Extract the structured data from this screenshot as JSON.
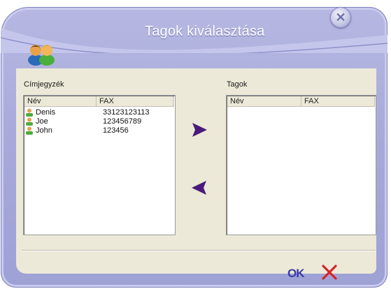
{
  "window": {
    "title": "Tagok kiválasztása",
    "close_symbol": "✕"
  },
  "address_book": {
    "label": "Címjegyzék",
    "columns": [
      "Név",
      "FAX"
    ],
    "rows": [
      {
        "name": "Denis",
        "fax": "33123123113"
      },
      {
        "name": "Joe",
        "fax": "123456789"
      },
      {
        "name": "John",
        "fax": "123456"
      }
    ]
  },
  "members": {
    "label": "Tagok",
    "columns": [
      "Név",
      "FAX"
    ],
    "rows": []
  },
  "actions": {
    "add_icon": "arrow-right-icon",
    "remove_icon": "arrow-left-icon",
    "ok_label": "OK",
    "cancel_icon": "cancel-x-icon"
  },
  "colors": {
    "frame": "#a5a8d8",
    "content_bg": "#ece9d8",
    "arrow": "#4a1a7a",
    "ok": "#3a3aa8",
    "cancel": "#d8232a"
  }
}
